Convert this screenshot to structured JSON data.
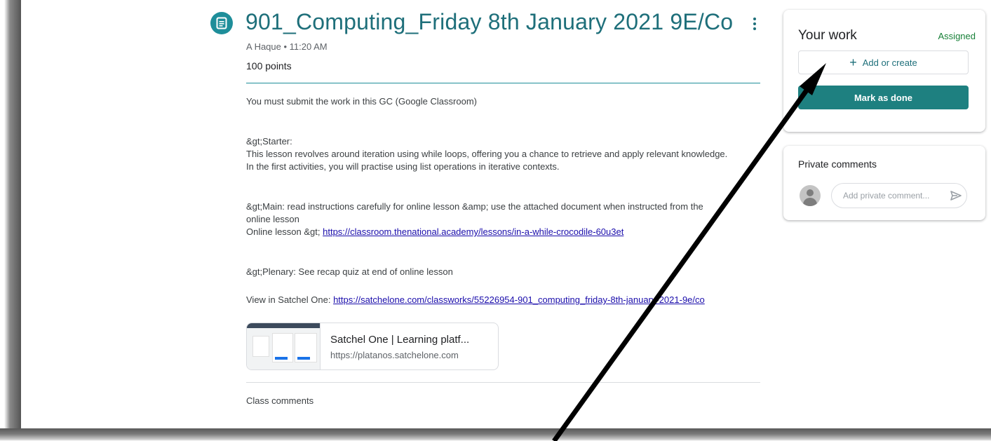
{
  "assignment": {
    "title": "901_Computing_Friday 8th January 2021 9E/Co",
    "meta": "A Haque • 11:20 AM",
    "points": "100 points",
    "icon": "assignment-icon",
    "more_icon": "more-vert-icon"
  },
  "instructions": {
    "line1": "You must submit the work in this GC (Google Classroom)",
    "starter_heading": "&gt;Starter:",
    "starter_line1": "This lesson revolves around iteration using while loops, offering you a chance to retrieve and apply relevant knowledge.",
    "starter_line2": "In the first activities, you will practise using list operations in iterative contexts.",
    "main_line1": "&gt;Main: read instructions carefully for online lesson &amp; use the attached document when instructed from the",
    "main_line2": "online lesson",
    "online_prefix": "Online lesson &gt; ",
    "online_link": "https://classroom.thenational.academy/lessons/in-a-while-crocodile-60u3et",
    "plenary": "&gt;Plenary: See recap quiz at end of online lesson",
    "satchel_prefix": "View in Satchel One: ",
    "satchel_link": "https://satchelone.com/classworks/55226954-901_computing_friday-8th-january-2021-9e/co"
  },
  "attachment": {
    "title": "Satchel One | Learning platf...",
    "url": "https://platanos.satchelone.com"
  },
  "class_comments": "Class comments",
  "your_work": {
    "title": "Your work",
    "status": "Assigned",
    "add_label": "Add or create",
    "done_label": "Mark as done",
    "status_color": "#188038",
    "accent_color": "#1e8080"
  },
  "private_comments": {
    "title": "Private comments",
    "placeholder": "Add private comment...",
    "send_icon": "send-icon",
    "avatar_icon": "avatar-icon"
  }
}
